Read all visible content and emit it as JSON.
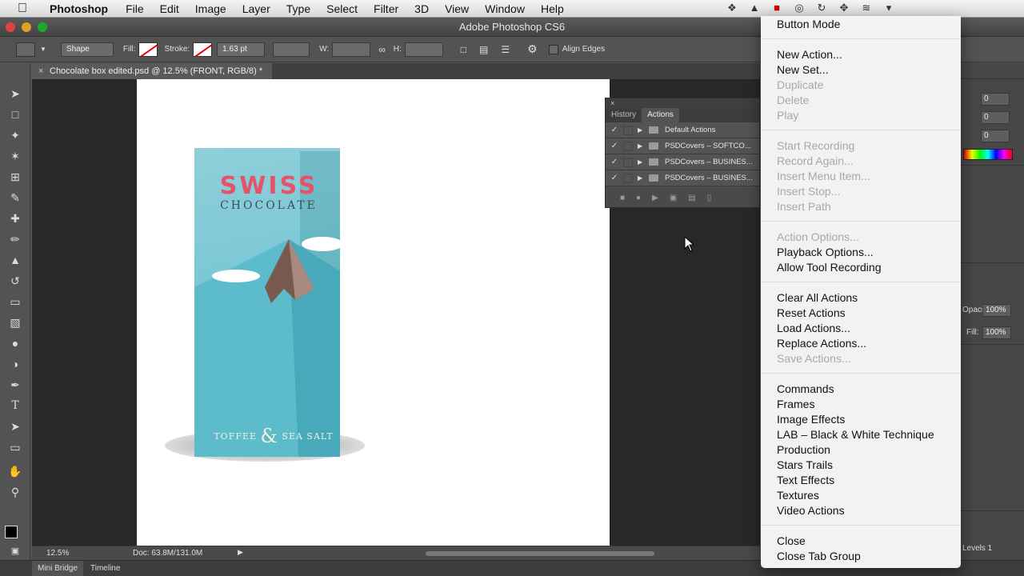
{
  "menubar": {
    "app": "Photoshop",
    "items": [
      "File",
      "Edit",
      "Image",
      "Layer",
      "Type",
      "Select",
      "Filter",
      "3D",
      "View",
      "Window",
      "Help"
    ]
  },
  "window": {
    "title": "Adobe Photoshop CS6"
  },
  "options": {
    "mode": "Shape",
    "fill_label": "Fill:",
    "stroke_label": "Stroke:",
    "stroke_width": "1.63 pt",
    "w_label": "W:",
    "h_label": "H:",
    "align_edges": "Align Edges"
  },
  "document": {
    "tab_title": "Chocolate box edited.psd @ 12.5% (FRONT, RGB/8) *",
    "box_title": "SWISS",
    "box_subtitle": "CHOCOLATE",
    "box_flavor_left": "TOFFEE",
    "box_flavor_amp": "&",
    "box_flavor_right": "SEA SALT"
  },
  "actions_panel": {
    "close": "×",
    "tabs": [
      "History",
      "Actions"
    ],
    "active_tab": "Actions",
    "rows": [
      {
        "name": "Default Actions"
      },
      {
        "name": "PSDCovers – SOFTCO..."
      },
      {
        "name": "PSDCovers – BUSINES..."
      },
      {
        "name": "PSDCovers – BUSINES..."
      }
    ]
  },
  "right_panel": {
    "values": [
      "0",
      "0",
      "0"
    ],
    "opacity_label": "Opacity:",
    "opacity_value": "100%",
    "fill_label": "Fill:",
    "fill_value": "100%",
    "layer_name": "Levels 1"
  },
  "status": {
    "zoom": "12.5%",
    "doc": "Doc: 63.8M/131.0M"
  },
  "bottom_tabs": [
    "Mini Bridge",
    "Timeline"
  ],
  "menu": {
    "groups": [
      [
        {
          "label": "Button Mode",
          "enabled": true
        }
      ],
      [
        {
          "label": "New Action...",
          "enabled": true
        },
        {
          "label": "New Set...",
          "enabled": true
        },
        {
          "label": "Duplicate",
          "enabled": false
        },
        {
          "label": "Delete",
          "enabled": false
        },
        {
          "label": "Play",
          "enabled": false
        }
      ],
      [
        {
          "label": "Start Recording",
          "enabled": false
        },
        {
          "label": "Record Again...",
          "enabled": false
        },
        {
          "label": "Insert Menu Item...",
          "enabled": false
        },
        {
          "label": "Insert Stop...",
          "enabled": false
        },
        {
          "label": "Insert Path",
          "enabled": false
        }
      ],
      [
        {
          "label": "Action Options...",
          "enabled": false
        },
        {
          "label": "Playback Options...",
          "enabled": true
        },
        {
          "label": "Allow Tool Recording",
          "enabled": true
        }
      ],
      [
        {
          "label": "Clear All Actions",
          "enabled": true
        },
        {
          "label": "Reset Actions",
          "enabled": true
        },
        {
          "label": "Load Actions...",
          "enabled": true
        },
        {
          "label": "Replace Actions...",
          "enabled": true
        },
        {
          "label": "Save Actions...",
          "enabled": false
        }
      ],
      [
        {
          "label": "Commands",
          "enabled": true
        },
        {
          "label": "Frames",
          "enabled": true
        },
        {
          "label": "Image Effects",
          "enabled": true
        },
        {
          "label": "LAB – Black & White Technique",
          "enabled": true
        },
        {
          "label": "Production",
          "enabled": true
        },
        {
          "label": "Stars Trails",
          "enabled": true
        },
        {
          "label": "Text Effects",
          "enabled": true
        },
        {
          "label": "Textures",
          "enabled": true
        },
        {
          "label": "Video Actions",
          "enabled": true
        }
      ],
      [
        {
          "label": "Close",
          "enabled": true
        },
        {
          "label": "Close Tab Group",
          "enabled": true
        }
      ]
    ]
  },
  "colors": {
    "box_top": "#8fcfda",
    "box_title": "#e5536a",
    "menu_disabled": "#a8a8a8"
  }
}
